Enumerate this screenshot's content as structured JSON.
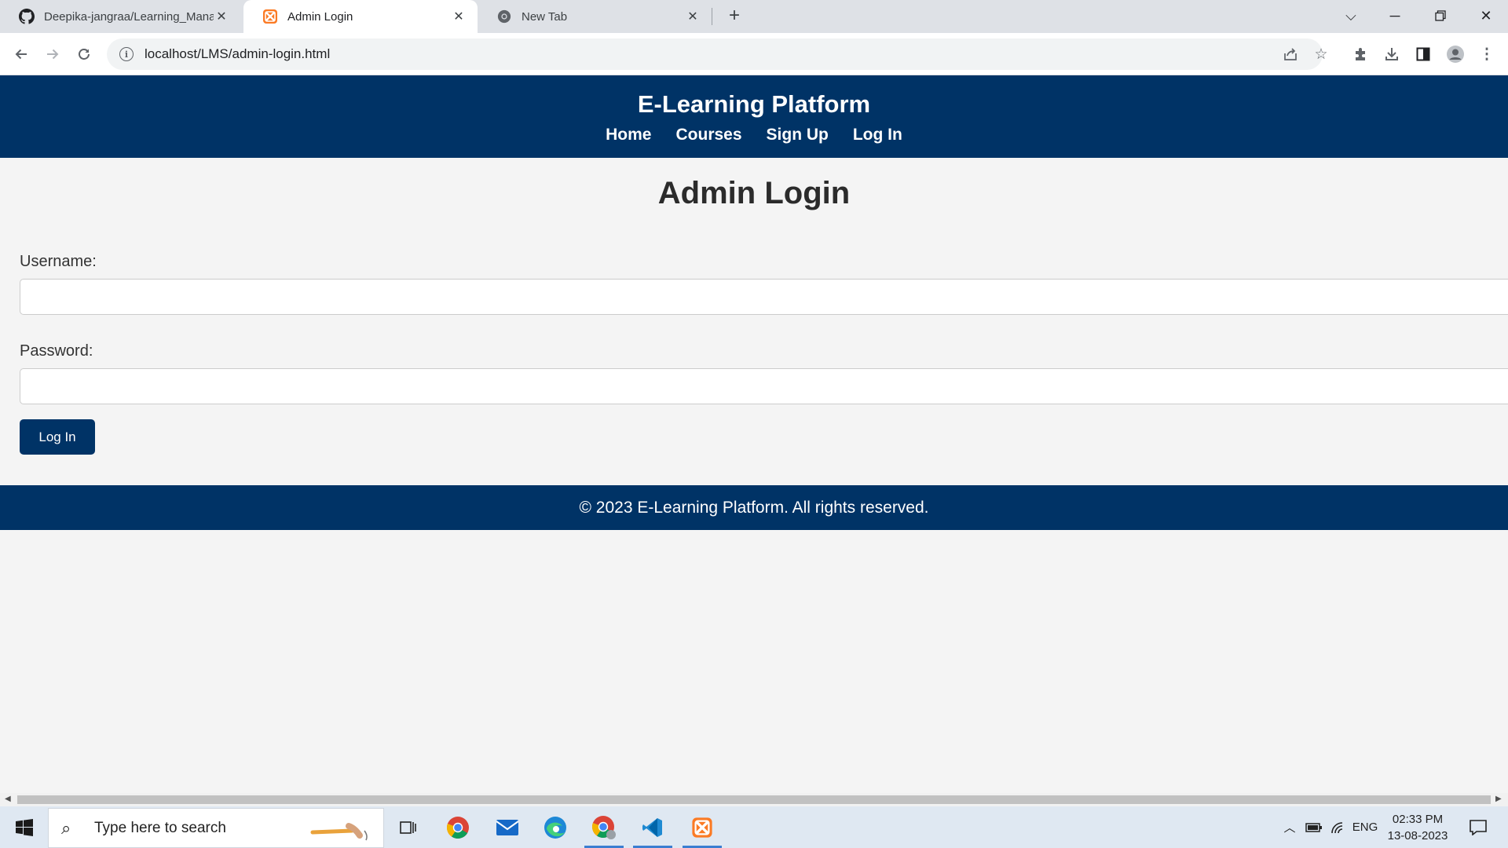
{
  "browser": {
    "tabs": [
      {
        "title": "Deepika-jangraa/Learning_Mana…",
        "icon": "github-icon",
        "active": false
      },
      {
        "title": "Admin Login",
        "icon": "xampp-icon",
        "active": true
      },
      {
        "title": "New Tab",
        "icon": "chrome-icon",
        "active": false
      }
    ],
    "address": "localhost/LMS/admin-login.html"
  },
  "site": {
    "title": "E-Learning Platform",
    "nav": [
      "Home",
      "Courses",
      "Sign Up",
      "Log In"
    ],
    "page_title": "Admin Login",
    "form": {
      "username_label": "Username:",
      "username_value": "",
      "password_label": "Password:",
      "password_value": "",
      "submit_label": "Log In"
    },
    "footer": "© 2023 E-Learning Platform. All rights reserved."
  },
  "taskbar": {
    "search_placeholder": "Type here to search",
    "language": "ENG",
    "time": "02:33 PM",
    "date": "13-08-2023"
  },
  "colors": {
    "brand": "#003366",
    "page_bg": "#f4f4f4"
  }
}
